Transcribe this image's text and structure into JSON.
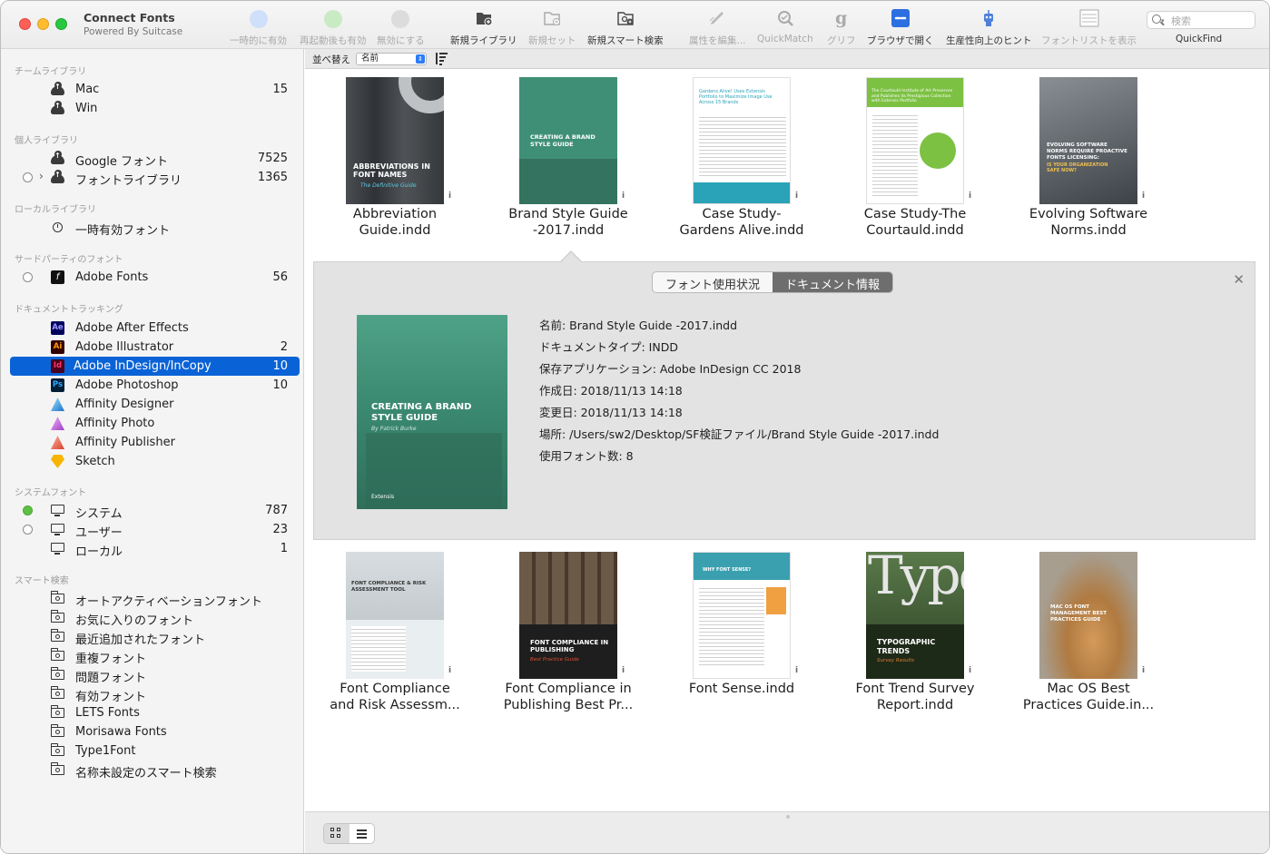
{
  "app": {
    "title": "Connect Fonts",
    "subtitle": "Powered By Suitcase"
  },
  "toolbar": {
    "items": [
      {
        "label": "一時的に有効",
        "icon": "temp-activate-icon",
        "enabled": false
      },
      {
        "label": "再起動後も有効",
        "icon": "perm-activate-icon",
        "enabled": false
      },
      {
        "label": "無効にする",
        "icon": "deactivate-icon",
        "enabled": false
      },
      {
        "label": "新規ライブラリ",
        "icon": "new-library-icon",
        "enabled": true
      },
      {
        "label": "新規セット",
        "icon": "new-set-icon",
        "enabled": false
      },
      {
        "label": "新規スマート検索",
        "icon": "new-smart-search-icon",
        "enabled": true
      },
      {
        "label": "属性を編集...",
        "icon": "edit-attributes-icon",
        "enabled": false
      },
      {
        "label": "QuickMatch",
        "icon": "quickmatch-icon",
        "enabled": false
      },
      {
        "label": "グリフ",
        "icon": "glyph-icon",
        "enabled": false
      },
      {
        "label": "ブラウザで開く",
        "icon": "open-in-browser-icon",
        "enabled": true
      },
      {
        "label": "生産性向上のヒント",
        "icon": "productivity-tips-icon",
        "enabled": true
      },
      {
        "label": "フォントリストを表示",
        "icon": "font-list-icon",
        "enabled": false
      }
    ],
    "search_placeholder": "検索",
    "quickfind_label": "QuickFind",
    "colors": {
      "temp": "#cfe0fb",
      "perm": "#c9ebc4",
      "deactivate": "#dcdcdc",
      "browser": "#2d6fe0"
    }
  },
  "sidebar": {
    "sections": [
      {
        "header": "チームライブラリ",
        "items": [
          {
            "label": "Mac",
            "count": "15",
            "icon": "cloud-icon"
          },
          {
            "label": "Win",
            "count": "",
            "icon": "cloud-icon"
          }
        ]
      },
      {
        "header": "個人ライブラリ",
        "items": [
          {
            "label": "Google フォント",
            "count": "7525",
            "icon": "cloud-icon"
          },
          {
            "label": "フォントライブラリ",
            "count": "1365",
            "icon": "cloud-icon"
          }
        ]
      },
      {
        "header": "ローカルライブラリ",
        "items": [
          {
            "label": "一時有効フォント",
            "count": "",
            "icon": "clock-icon"
          }
        ]
      },
      {
        "header": "サードパーティのフォント",
        "items": [
          {
            "label": "Adobe Fonts",
            "count": "56",
            "icon": "adobe-fonts-icon"
          }
        ]
      },
      {
        "header": "ドキュメントトラッキング",
        "items": [
          {
            "label": "Adobe After Effects",
            "count": "",
            "icon": "after-effects-icon"
          },
          {
            "label": "Adobe Illustrator",
            "count": "2",
            "icon": "illustrator-icon"
          },
          {
            "label": "Adobe InDesign/InCopy",
            "count": "10",
            "icon": "indesign-icon"
          },
          {
            "label": "Adobe Photoshop",
            "count": "10",
            "icon": "photoshop-icon"
          },
          {
            "label": "Affinity Designer",
            "count": "",
            "icon": "affinity-designer-icon"
          },
          {
            "label": "Affinity Photo",
            "count": "",
            "icon": "affinity-photo-icon"
          },
          {
            "label": "Affinity Publisher",
            "count": "",
            "icon": "affinity-publisher-icon"
          },
          {
            "label": "Sketch",
            "count": "",
            "icon": "sketch-icon"
          }
        ]
      },
      {
        "header": "システムフォント",
        "items": [
          {
            "label": "システム",
            "count": "787",
            "icon": "monitor-icon"
          },
          {
            "label": "ユーザー",
            "count": "23",
            "icon": "monitor-icon"
          },
          {
            "label": "ローカル",
            "count": "1",
            "icon": "monitor-icon"
          }
        ]
      },
      {
        "header": "スマート検索",
        "items": [
          {
            "label": "オートアクティベーションフォント",
            "icon": "smart-folder-icon"
          },
          {
            "label": "お気に入りのフォント",
            "icon": "smart-folder-icon"
          },
          {
            "label": "最近追加されたフォント",
            "icon": "smart-folder-icon"
          },
          {
            "label": "重複フォント",
            "icon": "smart-folder-icon"
          },
          {
            "label": "問題フォント",
            "icon": "smart-folder-icon"
          },
          {
            "label": "有効フォント",
            "icon": "smart-folder-icon"
          },
          {
            "label": "LETS Fonts",
            "icon": "smart-folder-icon"
          },
          {
            "label": "Morisawa Fonts",
            "icon": "smart-folder-icon"
          },
          {
            "label": "Type1Font",
            "icon": "smart-folder-icon"
          },
          {
            "label": "名称未設定のスマート検索",
            "icon": "smart-folder-icon"
          }
        ]
      }
    ],
    "selected": "Adobe InDesign/InCopy"
  },
  "sort": {
    "label": "並べ替え",
    "value": "名前"
  },
  "documents_row1": [
    {
      "name_line1": "Abbreviation",
      "name_line2": "Guide.indd",
      "cover_title": "ABBREVIATIONS IN FONT NAMES",
      "cover_sub": "The Definitive Guide",
      "bg": "#3b3f44"
    },
    {
      "name_line1": "Brand Style Guide",
      "name_line2": "-2017.indd",
      "cover_title": "CREATING A BRAND STYLE GUIDE",
      "cover_sub": "",
      "bg": "#3f8f77"
    },
    {
      "name_line1": "Case Study-",
      "name_line2": "Gardens Alive.indd",
      "cover_title": "Gardens Alive! Uses Extensis Portfolio to Maximize Image Use Across 15 Brands",
      "cover_sub": "",
      "bg": "#ffffff"
    },
    {
      "name_line1": "Case Study-The",
      "name_line2": "Courtauld.indd",
      "cover_title": "The Courtauld Institute of Art Preserves and Publishes its Prestigious Collection with Extensis Portfolio",
      "cover_sub": "",
      "bg": "#ffffff"
    },
    {
      "name_line1": "Evolving Software",
      "name_line2": "Norms.indd",
      "cover_title": "EVOLVING SOFTWARE NORMS REQUIRE PROACTIVE FONTS LICENSING:",
      "cover_sub": "IS YOUR ORGANIZATION SAFE NOW?",
      "bg": "#5a5f66"
    }
  ],
  "documents_row2": [
    {
      "name_line1": "Font Compliance",
      "name_line2": "and Risk Assessm...",
      "cover_title": "FONT COMPLIANCE & RISK ASSESSMENT TOOL",
      "cover_sub": "",
      "bg": "#e9eef0"
    },
    {
      "name_line1": "Font Compliance in",
      "name_line2": "Publishing Best Pr...",
      "cover_title": "FONT COMPLIANCE IN PUBLISHING",
      "cover_sub": "Best Practice Guide",
      "bg": "#3d3a36"
    },
    {
      "name_line1": "Font Sense.indd",
      "name_line2": "",
      "cover_title": "WHY FONT SENSE?",
      "cover_sub": "",
      "bg": "#ffffff"
    },
    {
      "name_line1": "Font Trend Survey",
      "name_line2": "Report.indd",
      "cover_title": "TYPOGRAPHIC TRENDS",
      "cover_sub": "Survey Results",
      "bg": "#3f5a34"
    },
    {
      "name_line1": "Mac OS Best",
      "name_line2": "Practices Guide.in...",
      "cover_title": "MAC OS FONT MANAGEMENT BEST PRACTICES GUIDE",
      "cover_sub": "",
      "bg": "#b9b2a6"
    }
  ],
  "detail": {
    "tabs": [
      "フォント使用状況",
      "ドキュメント情報"
    ],
    "active_tab": "ドキュメント情報",
    "cover_title": "CREATING A BRAND STYLE GUIDE",
    "cover_sub": "By Patrick Burke",
    "cover_brand": "Extensis",
    "info": [
      "名前: Brand Style Guide -2017.indd",
      "ドキュメントタイプ: INDD",
      "保存アプリケーション: Adobe InDesign CC 2018",
      "作成日: 2018/11/13 14:18",
      "変更日: 2018/11/13 14:18",
      "場所: /Users/sw2/Desktop/SF検証ファイル/Brand Style Guide -2017.indd",
      "使用フォント数: 8"
    ]
  }
}
